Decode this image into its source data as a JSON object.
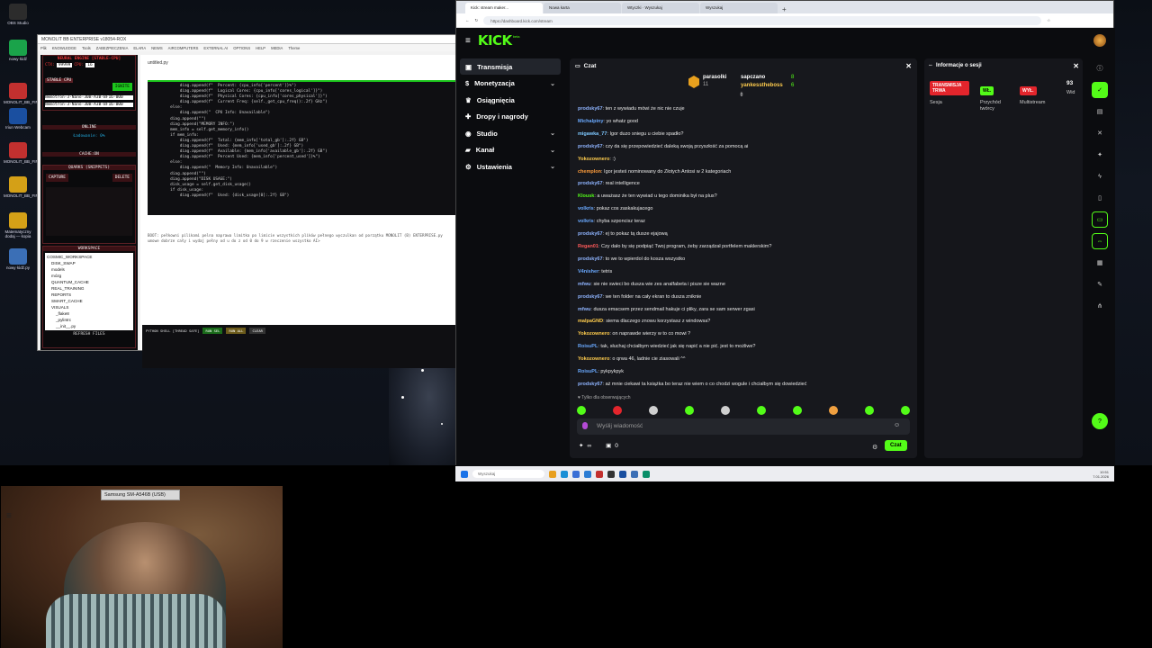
{
  "desktop": {
    "icons": [
      {
        "label": "OBS Studio",
        "color": "#2c2c2c"
      },
      {
        "label": "nowy łódź",
        "color": "#1aa34a"
      },
      {
        "label": "MONOLIT_BB_FIN...",
        "color": "#c2302f"
      },
      {
        "label": "Iriun Webcam",
        "color": "#1a4fa0"
      },
      {
        "label": "MONOLIT_BB_FIN...",
        "color": "#c2302f"
      },
      {
        "label": "MONOLIT_BB_FIN...",
        "color": "#d4a017"
      },
      {
        "label": "Matematyczny dodaj — kopia",
        "color": "#d4a017"
      },
      {
        "label": "nowy łódź.py",
        "color": "#3b6fb6"
      }
    ]
  },
  "ide": {
    "title": "MONOLIT BB ENTERPRISE v18054-ROX",
    "menu": [
      "Plik",
      "KNOWLEDGE",
      "Tools",
      "ZABEZPIECZENIA",
      "ELARA",
      "NEWS",
      "AIRCOMPUTERS",
      "EXTERNAL AI",
      "OPTIONS",
      "HELP",
      "MEDIA",
      "Theme"
    ],
    "neural_title": "NEURAL ENGINE [STABLE-CPU]",
    "ctx_label": "CTX:",
    "ctx_value": "99999",
    "cpu_label": "CPU:",
    "cpu_value": "16",
    "stable_badge": "STABLE CPU",
    "ignite_label": "IGNITE",
    "model_1": "Nemotron-3-Nano-30B-A3B-BF16-000",
    "model_2": "Nemotron-3-Nano-30B-A3B-BF16-000",
    "online_label": "ONLINE",
    "progress_label": "Ładowanie: 0%",
    "progress_value": 0,
    "cache_label": "CACHE:ON",
    "quarks_title": "QUARKS (SNIPPETS)",
    "capture_label": "CAPTURE",
    "delete_label": "DELETE",
    "workspace_title": "WORKSPACE",
    "tree": [
      "COSMIC_WORKSPACE",
      "DISK_SWAP",
      "models",
      "mózg",
      "QUANTUM_CACHE",
      "REAL_TRAINING",
      "REPORTS",
      "SMART_CACHE",
      "VISUALS",
      "_flake8",
      "_pylintrc",
      "__init__.py"
    ],
    "refresh_label": "REFRESH FILES",
    "file_tab": "untitled.py",
    "code": "            diag.append(f\"  Percent: {cpu_info['percent']}%\")\n            diag.append(f\"  Logical Cores: {cpu_info['cores_logical']}\")\n            diag.append(f\"  Physical Cores: {cpu_info['cores_physical']}\")\n            diag.append(f\"  Current Freq: {self._get_cpu_freq():.2f} GHz\")\n        else:\n            diag.append(\"  CPU Info: Unavailable\")\n        diag.append(\"\")\n        diag.append(\"MEMORY INFO:\")\n        mem_info = self.get_memory_info()\n        if mem_info:\n            diag.append(f\"  Total: {mem_info['total_gb']:.2f} GB\")\n            diag.append(f\"  Used: {mem_info['used_gb']:.2f} GB\")\n            diag.append(f\"  Available: {mem_info['available_gb']:.2f} GB\")\n            diag.append(f\"  Percent Used: {mem_info['percent_used']}%\")\n        else:\n            diag.append(\"  Memory Info: Unavailable\")\n        diag.append(\"\")\n        diag.append(\"DISK USAGE:\")\n        disk_usage = self.get_disk_usage()\n        if disk_usage:\n            diag.append(f\"  Used: {disk_usage[0]:.2f} GB\")",
    "console_text": "BOOT: pełkowni pilikami pelna naprawa limitka po limicie wszystkich plików pełnego wyczulkan od porzątku MONOLIT (B) ENTERPRISE.py umowe dobrze cały i wydaj pełny od u do z od 0 do 9 w rzeczenie wszystko AI>",
    "shell_title": "PYTHON SHELL [THREAD SAFE]",
    "shell_buttons": [
      "RUN SEL",
      "RUN ALL",
      "CLEAR"
    ]
  },
  "browser": {
    "tabs": [
      "Kick: stream maker...",
      "Nowa karta",
      "Wtyczki · Wyszukaj",
      "Wyszukaj"
    ],
    "url": "https://dashboard.kick.com/stream"
  },
  "kick": {
    "logo": "KICK",
    "logo_badge": "beta",
    "nav": [
      {
        "label": "Transmisja",
        "icon": "broadcast-icon",
        "active": true,
        "chevron": false
      },
      {
        "label": "Monetyzacja",
        "icon": "dollar-icon",
        "active": false,
        "chevron": true
      },
      {
        "label": "Osiągnięcia",
        "icon": "trophy-icon",
        "active": false,
        "chevron": false
      },
      {
        "label": "Dropy i nagrody",
        "icon": "gift-icon",
        "active": false,
        "chevron": false
      },
      {
        "label": "Studio",
        "icon": "studio-icon",
        "active": false,
        "chevron": true
      },
      {
        "label": "Kanał",
        "icon": "channel-icon",
        "active": false,
        "chevron": true
      },
      {
        "label": "Ustawienia",
        "icon": "gear-icon",
        "active": false,
        "chevron": true
      }
    ],
    "chat": {
      "title": "Czat",
      "leaders": [
        {
          "name": "parasolki",
          "count": "11"
        },
        {
          "name": "sapczano",
          "count": "8"
        },
        {
          "name": "yankesstheboss",
          "count": "6"
        }
      ],
      "messages": [
        {
          "user": "prodsky67",
          "color": "#8fb4ff",
          "text": "ten z wywiadu mówi że nic nie czuje"
        },
        {
          "user": "Michalpiny",
          "color": "#6aa9ff",
          "text": "yo whatz good"
        },
        {
          "user": "migawka_77",
          "color": "#7ec8ff",
          "text": "Igor duzo sniegu u ciebie spadło?"
        },
        {
          "user": "prodsky67",
          "color": "#8fb4ff",
          "text": "czy da się przepowiedzieć daleką swoją przyszłość za pomocą ai"
        },
        {
          "user": "Yokozownero",
          "color": "#ffcc4d",
          "text": ":)"
        },
        {
          "user": "chemplon",
          "color": "#ff9d3b",
          "text": "Igor jesteś nominowany do Złotych Antosi w 2 kategoriach"
        },
        {
          "user": "prodsky67",
          "color": "#8fb4ff",
          "text": "real intelligence"
        },
        {
          "user": "Klousk",
          "color": "#53fc18",
          "text": "a uważasz że ten wywiad u tego dominika był na plus?"
        },
        {
          "user": "volkris",
          "color": "#6aa9ff",
          "text": "pokaz cos zaskakujacego"
        },
        {
          "user": "volkris",
          "color": "#6aa9ff",
          "text": "chyba szponcisz teraz"
        },
        {
          "user": "prodsky67",
          "color": "#8fb4ff",
          "text": "ej to pokaz tą dusze ejajową"
        },
        {
          "user": "Regan01",
          "color": "#ff5a5a",
          "text": "Czy dało by się podpiąć Twoj program, żeby zarządzał portfelem maklerskim?"
        },
        {
          "user": "prodsky67",
          "color": "#8fb4ff",
          "text": "to we to wpierdol do kosza wszystko"
        },
        {
          "user": "V4nisher",
          "color": "#6aa9ff",
          "text": "tetris"
        },
        {
          "user": "mfwu",
          "color": "#8fb4ff",
          "text": "sie nie swieci bo dusza wie zes analfabeta i pisze sie wazne"
        },
        {
          "user": "prodsky67",
          "color": "#8fb4ff",
          "text": "we ten folder na cały ekran to dusza zniknie"
        },
        {
          "user": "mfwu",
          "color": "#8fb4ff",
          "text": "dusza emacsem przez sendmail hakuje ci pliky, zara se sam serwer zgasi"
        },
        {
          "user": "malpaGND",
          "color": "#ffcc4d",
          "text": "siema dlaczego znowu korzystasz z windowsa?"
        },
        {
          "user": "Yokozownero",
          "color": "#ffcc4d",
          "text": "on naprawde wierzy w to co mowi ?"
        },
        {
          "user": "RoisuPL",
          "color": "#6aa9ff",
          "text": "tak, słuchaj chciałbym wiedzieć jak się napić a nie pić. jest to możliwe?"
        },
        {
          "user": "Yokozownero",
          "color": "#ffcc4d",
          "text": "o qrwa 46, ladnie cie ziasowali ^^"
        },
        {
          "user": "RoisuPL",
          "color": "#6aa9ff",
          "text": "pykpykpyk"
        },
        {
          "user": "prodsky67",
          "color": "#8fb4ff",
          "text": "aż mnie ciekawi ta książka bo teraz nie wiem o co chodzi wogule i chciałbym się dowiedzieć"
        }
      ],
      "mode_note": "Tylko dla obserwujących",
      "input_placeholder": "Wyślij wiadomość",
      "footer_count_a": "∞",
      "footer_count_b": "0",
      "send_label": "Czat"
    },
    "session": {
      "title": "Informacje o sesji",
      "live_badge": "TRANSMISJA TRWA",
      "session_label": "Sesja",
      "creator_badge": "WŁ.",
      "creator_label": "Przychód twórcy",
      "multistream_badge": "WYŁ.",
      "multistream_label": "Multistream",
      "viewers": "93",
      "viewers_label": "Wid"
    }
  },
  "taskbar": {
    "search_placeholder": "Wyszukaj",
    "time": "10:51",
    "date": "7.01.2026"
  },
  "webcam": {
    "label": "Samsung SM-A546B (USB)"
  },
  "colors": {
    "kick_green": "#53fc18",
    "live_red": "#e3252c"
  }
}
